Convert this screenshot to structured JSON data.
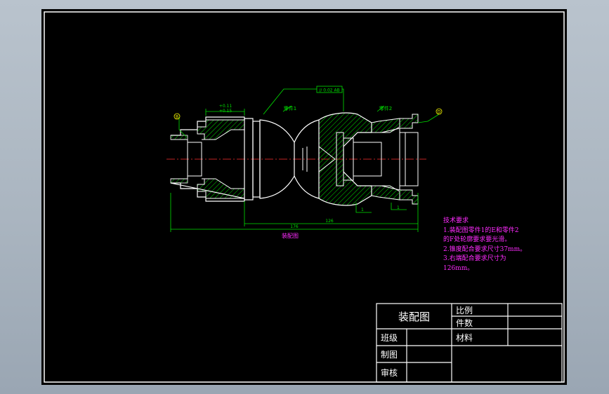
{
  "drawing": {
    "caption": "装配图",
    "dim_overall": "176",
    "dim_partial": "126",
    "tolerance_upper": "+0.11",
    "tolerance_lower": "+0.15",
    "fcf_text": "// 0.02 AB",
    "datum_left": "B",
    "datum_right": "D",
    "label_left_piece": "零件1",
    "label_right_piece": "零件2",
    "taper_left": "1",
    "taper_right": "1"
  },
  "notes": {
    "title": "技术要求",
    "lines": [
      "1.装配图零件1的E和零件2",
      "的F处轮廓要求要光滑。",
      "2.锥度配合要求尺寸37mm。",
      "3.右端配合要求尺寸为",
      "126mm。"
    ]
  },
  "title_block": {
    "drawing_title": "装配图",
    "scale_label": "比例",
    "quantity_label": "件数",
    "material_label": "材料",
    "class_label": "班级",
    "drafter_label": "制图",
    "reviewer_label": "审核"
  },
  "colors": {
    "outline": "#ffffff",
    "hatch": "#00e000",
    "dimension": "#00e000",
    "notes": "#ff2bff",
    "centerline": "#ff3030",
    "datum_marker": "#ffff00"
  }
}
